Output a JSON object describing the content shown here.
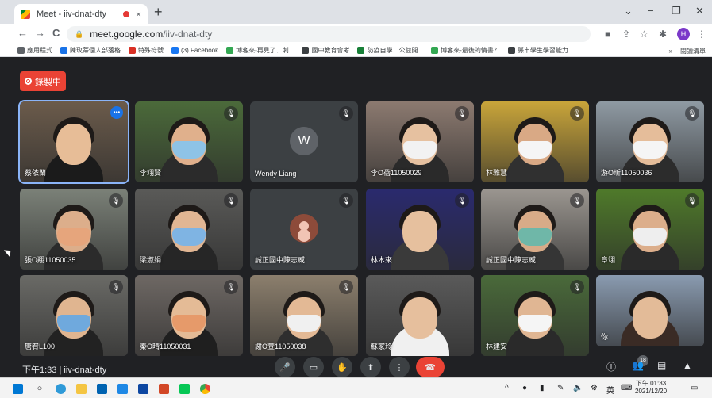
{
  "browser": {
    "tab_title": "Meet - iiv-dnat-dty",
    "tab_close": "×",
    "new_tab": "+",
    "window": {
      "minimize": "−",
      "restore": "❐",
      "close": "✕",
      "chevron": "⌄"
    },
    "nav": {
      "back": "←",
      "forward": "→",
      "reload": "C"
    },
    "url_host": "meet.google.com",
    "url_path": "/iiv-dnat-dty",
    "profile_initial": "H",
    "bookmarks": [
      {
        "label": "應用程式",
        "color": "#5f6368"
      },
      {
        "label": "陳玫蒂個人部落格",
        "color": "#1a73e8"
      },
      {
        "label": "特殊符號",
        "color": "#d93025"
      },
      {
        "label": "(3) Facebook",
        "color": "#1877f2"
      },
      {
        "label": "博客來-再見了．刺...",
        "color": "#34a853"
      },
      {
        "label": "國中教育會考",
        "color": "#3c4043"
      },
      {
        "label": "防疫自學．公益開...",
        "color": "#188038"
      },
      {
        "label": "博客來-最後的情書？",
        "color": "#34a853"
      },
      {
        "label": "縣市學生學習能力...",
        "color": "#3c4043"
      }
    ],
    "bookmarks_more": "»",
    "reading_list": "閱讀清單"
  },
  "meet": {
    "recording_label": "錄製中",
    "meeting_time": "下午1:33",
    "meeting_code": "iiv-dnat-dty",
    "participant_count": "18",
    "tiles": [
      {
        "name": "蔡依蘭",
        "type": "video",
        "bg": "#6b5b4b",
        "skin": "#e7bd97",
        "shirt": "#1b1b1b",
        "mask": "",
        "muted": false,
        "active": true
      },
      {
        "name": "李翊賢",
        "type": "video",
        "bg": "#4b6a3a",
        "skin": "#e0b08c",
        "shirt": "#2b2b2b",
        "mask": "#8ec3e6",
        "muted": true
      },
      {
        "name": "Wendy Liang",
        "type": "avatar",
        "initial": "W",
        "avatar_color": "#5f6368",
        "muted": true
      },
      {
        "name": "李O蓓11050029",
        "type": "video",
        "bg": "#8c7a70",
        "skin": "#e6c1a0",
        "shirt": "#2a2a2a",
        "mask": "#f2f2f2",
        "muted": true
      },
      {
        "name": "林雅慧",
        "type": "video",
        "bg": "#c9a53a",
        "skin": "#d9a985",
        "shirt": "#303030",
        "mask": "#f5f5f5",
        "muted": true
      },
      {
        "name": "游O昕11050036",
        "type": "video",
        "bg": "#8f9aa3",
        "skin": "#e5bd9a",
        "shirt": "#2c2c2c",
        "mask": "#f5f5f5",
        "muted": true
      },
      {
        "name": "張O翔11050035",
        "type": "video",
        "bg": "#7b8178",
        "skin": "#dcae8b",
        "shirt": "#2b2b2b",
        "mask": "#e6a57c",
        "muted": true
      },
      {
        "name": "梁淑娟",
        "type": "video",
        "bg": "#5a5a58",
        "skin": "#e1b693",
        "shirt": "#262626",
        "mask": "#7fb4e3",
        "muted": true
      },
      {
        "name": "誠正國中陳志威",
        "type": "avatar",
        "initial": "",
        "avatar_color": "#8d4b3a",
        "muted": true
      },
      {
        "name": "林木來",
        "type": "video",
        "bg": "#2a2a6e",
        "skin": "#e6c09e",
        "shirt": "#3a3a3a",
        "mask": "",
        "muted": true
      },
      {
        "name": "誠正國中陳志威",
        "type": "video",
        "bg": "#9b9690",
        "skin": "#d8ab88",
        "shirt": "#353535",
        "mask": "#6fb7a8",
        "muted": true
      },
      {
        "name": "章翊",
        "type": "video",
        "bg": "#4f7a2a",
        "skin": "#dcae8b",
        "shirt": "#2a2a2a",
        "mask": "#eeeeee",
        "muted": true
      },
      {
        "name": "唐宥L100",
        "type": "video",
        "bg": "#6a6a66",
        "skin": "#e0b590",
        "shirt": "#222222",
        "mask": "#6fa9dd",
        "muted": true
      },
      {
        "name": "秦O晴11050031",
        "type": "video",
        "bg": "#6e6864",
        "skin": "#e4bb96",
        "shirt": "#1f1f1f",
        "mask": "#e69a6a",
        "muted": true
      },
      {
        "name": "謝O萱11050038",
        "type": "video",
        "bg": "#8c7f6d",
        "skin": "#e3b995",
        "shirt": "#2e2e2e",
        "mask": "#f0f0f0",
        "muted": true
      },
      {
        "name": "蘇家玲",
        "type": "video",
        "bg": "#5a5a5a",
        "skin": "#e6bf9d",
        "shirt": "#f0f0f0",
        "mask": "",
        "muted": false
      },
      {
        "name": "林建安",
        "type": "video",
        "bg": "#4a6a3a",
        "skin": "#e0b693",
        "shirt": "#2a2a2a",
        "mask": "#f5f5f5",
        "muted": true
      },
      {
        "name": "你",
        "type": "video",
        "bg": "#8a9bb0",
        "skin": "#e3bb98",
        "shirt": "#3a2b25",
        "mask": "",
        "muted": false
      }
    ]
  },
  "taskbar": {
    "clock_time": "下午 01:33",
    "clock_date": "2021/12/20",
    "ime_label": "英"
  }
}
